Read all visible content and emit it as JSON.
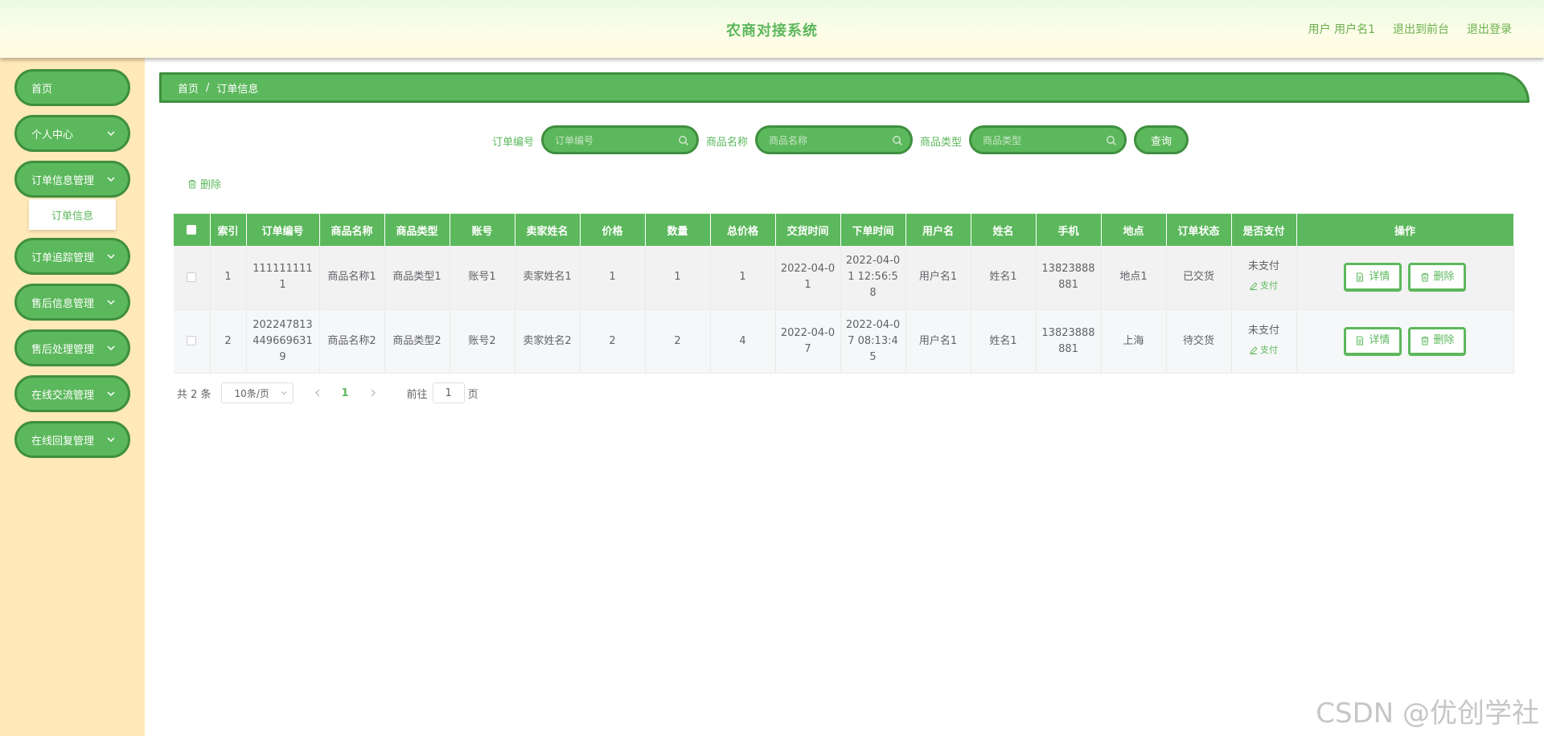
{
  "header": {
    "title": "农商对接系统",
    "user_label": "用户 用户名1",
    "back_front": "退出到前台",
    "logout": "退出登录"
  },
  "sidebar": {
    "items": [
      {
        "label": "首页",
        "has_chevron": false
      },
      {
        "label": "个人中心",
        "has_chevron": true
      },
      {
        "label": "订单信息管理",
        "has_chevron": true
      },
      {
        "label": "订单追踪管理",
        "has_chevron": true
      },
      {
        "label": "售后信息管理",
        "has_chevron": true
      },
      {
        "label": "售后处理管理",
        "has_chevron": true
      },
      {
        "label": "在线交流管理",
        "has_chevron": true
      },
      {
        "label": "在线回复管理",
        "has_chevron": true
      }
    ],
    "submenu_item": "订单信息"
  },
  "breadcrumb": {
    "home": "首页",
    "separator": "/",
    "current": "订单信息"
  },
  "search": {
    "order_no_label": "订单编号",
    "order_no_placeholder": "订单编号",
    "product_name_label": "商品名称",
    "product_name_placeholder": "商品名称",
    "product_type_label": "商品类型",
    "product_type_placeholder": "商品类型",
    "query_button": "查询"
  },
  "toolbar": {
    "delete_label": "删除"
  },
  "table": {
    "headers": [
      "索引",
      "订单编号",
      "商品名称",
      "商品类型",
      "账号",
      "卖家姓名",
      "价格",
      "数量",
      "总价格",
      "交货时间",
      "下单时间",
      "用户名",
      "姓名",
      "手机",
      "地点",
      "订单状态",
      "是否支付",
      "操作"
    ],
    "rows": [
      {
        "index": "1",
        "order_no": "1111111111",
        "product_name": "商品名称1",
        "product_type": "商品类型1",
        "account": "账号1",
        "seller": "卖家姓名1",
        "price": "1",
        "quantity": "1",
        "total": "1",
        "delivery_time": "2022-04-01",
        "order_time": "2022-04-01 12:56:58",
        "username": "用户名1",
        "name": "姓名1",
        "phone": "13823888881",
        "location": "地点1",
        "status": "已交货",
        "paid": "未支付",
        "pay_link": "支付",
        "detail_btn": "详情",
        "delete_btn": "删除"
      },
      {
        "index": "2",
        "order_no": "2022478134496696319",
        "product_name": "商品名称2",
        "product_type": "商品类型2",
        "account": "账号2",
        "seller": "卖家姓名2",
        "price": "2",
        "quantity": "2",
        "total": "4",
        "delivery_time": "2022-04-07",
        "order_time": "2022-04-07 08:13:45",
        "username": "用户名1",
        "name": "姓名1",
        "phone": "13823888881",
        "location": "上海",
        "status": "待交货",
        "paid": "未支付",
        "pay_link": "支付",
        "detail_btn": "详情",
        "delete_btn": "删除"
      }
    ]
  },
  "pagination": {
    "total": "共 2 条",
    "page_size": "10条/页",
    "current_page": "1",
    "goto_label": "前往",
    "goto_value": "1",
    "page_unit": "页"
  },
  "watermark": "CSDN @优创学社",
  "colors": {
    "accent": "#5cb85c",
    "accent_border": "#3f8f3f",
    "sidebar_bg": "#ffe9b8"
  }
}
